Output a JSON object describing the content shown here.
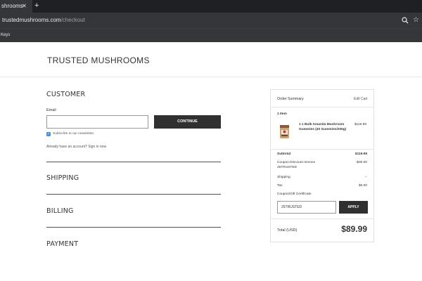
{
  "browser": {
    "tab_title": "shrooms",
    "tab_close": "✕",
    "new_tab": "+",
    "url_domain": "trustedmushrooms.com",
    "url_path": "/checkout",
    "bookmark": "Keys",
    "icons": [
      "zoom-icon",
      "star-icon"
    ]
  },
  "header": {
    "brand": "TRUSTED MUSHROOMS"
  },
  "checkout": {
    "customer_title": "CUSTOMER",
    "email_label": "Email",
    "email_value": "",
    "continue_label": "CONTINUE",
    "newsletter_label": "Subscribe to our newsletter.",
    "newsletter_checked": true,
    "signin_text": "Already have an account?",
    "signin_link": "Sign in now",
    "shipping_title": "SHIPPING",
    "billing_title": "BILLING",
    "payment_title": "PAYMENT"
  },
  "summary": {
    "title": "Order Summary",
    "edit_cart": "Edit Cart",
    "item_count": "1 Item",
    "product_name": "1 x Bulk Amanita Mushroom Gummies (40 Gummies/200g)",
    "product_price": "$119.99",
    "subtotal_label": "Subtotal",
    "subtotal_value": "$119.99",
    "coupon_label": "Coupon Discount remove 25TRUSTED",
    "coupon_value": "-$30.00",
    "shipping_label": "Shipping",
    "shipping_value": "--",
    "tax_label": "Tax",
    "tax_value": "$0.00",
    "gift_label": "Coupon/Gift Certificate",
    "gift_value": "25TRUSTED",
    "apply_label": "APPLY",
    "total_label": "Total (USD)",
    "total_value": "$89.99"
  }
}
